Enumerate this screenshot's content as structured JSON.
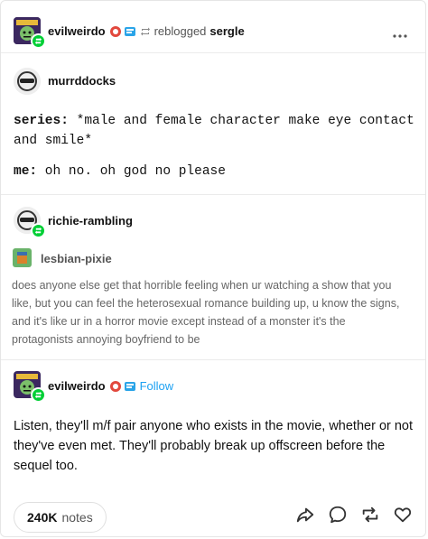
{
  "header": {
    "reblogger": "evilweirdo",
    "reblogged_text": "reblogged",
    "source": "sergle"
  },
  "first_post": {
    "user": "murrddocks",
    "lines": [
      {
        "key": "series:",
        "text": " *male and female character make eye contact"
      },
      {
        "key": "",
        "text": "and smile*"
      },
      {
        "key": "me:",
        "text": " oh no. oh god no please"
      }
    ]
  },
  "second_post": {
    "user": "richie-rambling",
    "quoted_user": "lesbian-pixie",
    "quote": "does anyone else get that horrible feeling when ur watching a show that you like, but you can feel the heterosexual romance building up, u know the signs, and it's like ur in a horror movie except instead of a monster it's the protagonists annoying boyfriend to be"
  },
  "third_post": {
    "user": "evilweirdo",
    "follow_label": "Follow",
    "text": "Listen, they'll m/f pair anyone who exists in the movie, whether or not they've even met. They'll probably break up offscreen before the sequel too."
  },
  "footer": {
    "notes_count": "240K",
    "notes_label": "notes"
  },
  "colors": {
    "reblog_green": "#00cf35",
    "follow_blue": "#1da1f2"
  }
}
